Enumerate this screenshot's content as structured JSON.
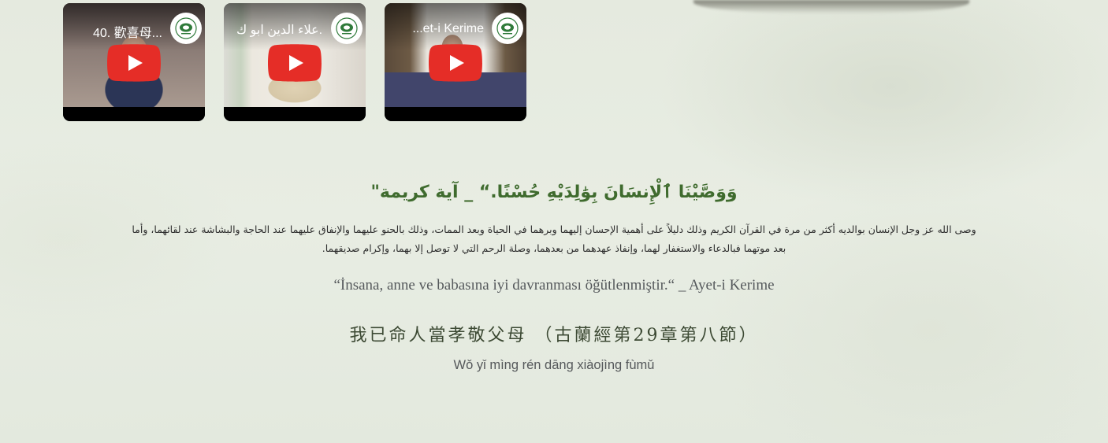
{
  "videos": [
    {
      "title": "40. 歡喜母...",
      "thumb_variant": "v1",
      "avatar_icon": "association-logo-icon",
      "play_icon": "youtube-play-icon"
    },
    {
      "title": "علاء الدين ابو ك...",
      "thumb_variant": "v2",
      "avatar_icon": "association-logo-icon",
      "play_icon": "youtube-play-icon"
    },
    {
      "title": "...et-i Kerime",
      "thumb_variant": "v3",
      "avatar_icon": "association-logo-icon",
      "play_icon": "youtube-play-icon"
    }
  ],
  "verse": {
    "arabic_heading": "وَوَصَّيْنَا ٱلْإِنسَانَ بِوَٰلِدَيْهِ حُسْنًا.“ _ آية كريمة\"",
    "arabic_body": "وصى الله عز وجل الإنسان بوالديه أكثر من مرة في القرآن الكريم وذلك دليلاً على أهمية الإحسان إليهما وبرهما في الحياة وبعد الممات، وذلك بالحنو عليهما والإنفاق عليهما عند الحاجة والبشاشة عند لقائهما، وأما بعد موتهما فبالدعاء والاستغفار لهما، وإنفاذ عهدهما من بعدهما، وصلة الرحم التي لا توصل إلا بهما، وإكرام صديقهما.",
    "turkish": "“İnsana, anne ve babasına iyi davranması öğütlenmiştir.“ _ Ayet-i Kerime",
    "chinese": "我已命人當孝敬父母 （古蘭經第29章第八節）",
    "pinyin": "Wǒ yǐ mìng rén dāng xiàojìng fùmǔ"
  },
  "colors": {
    "accent_green": "#3f6b2e",
    "youtube_red": "#e52d27"
  }
}
